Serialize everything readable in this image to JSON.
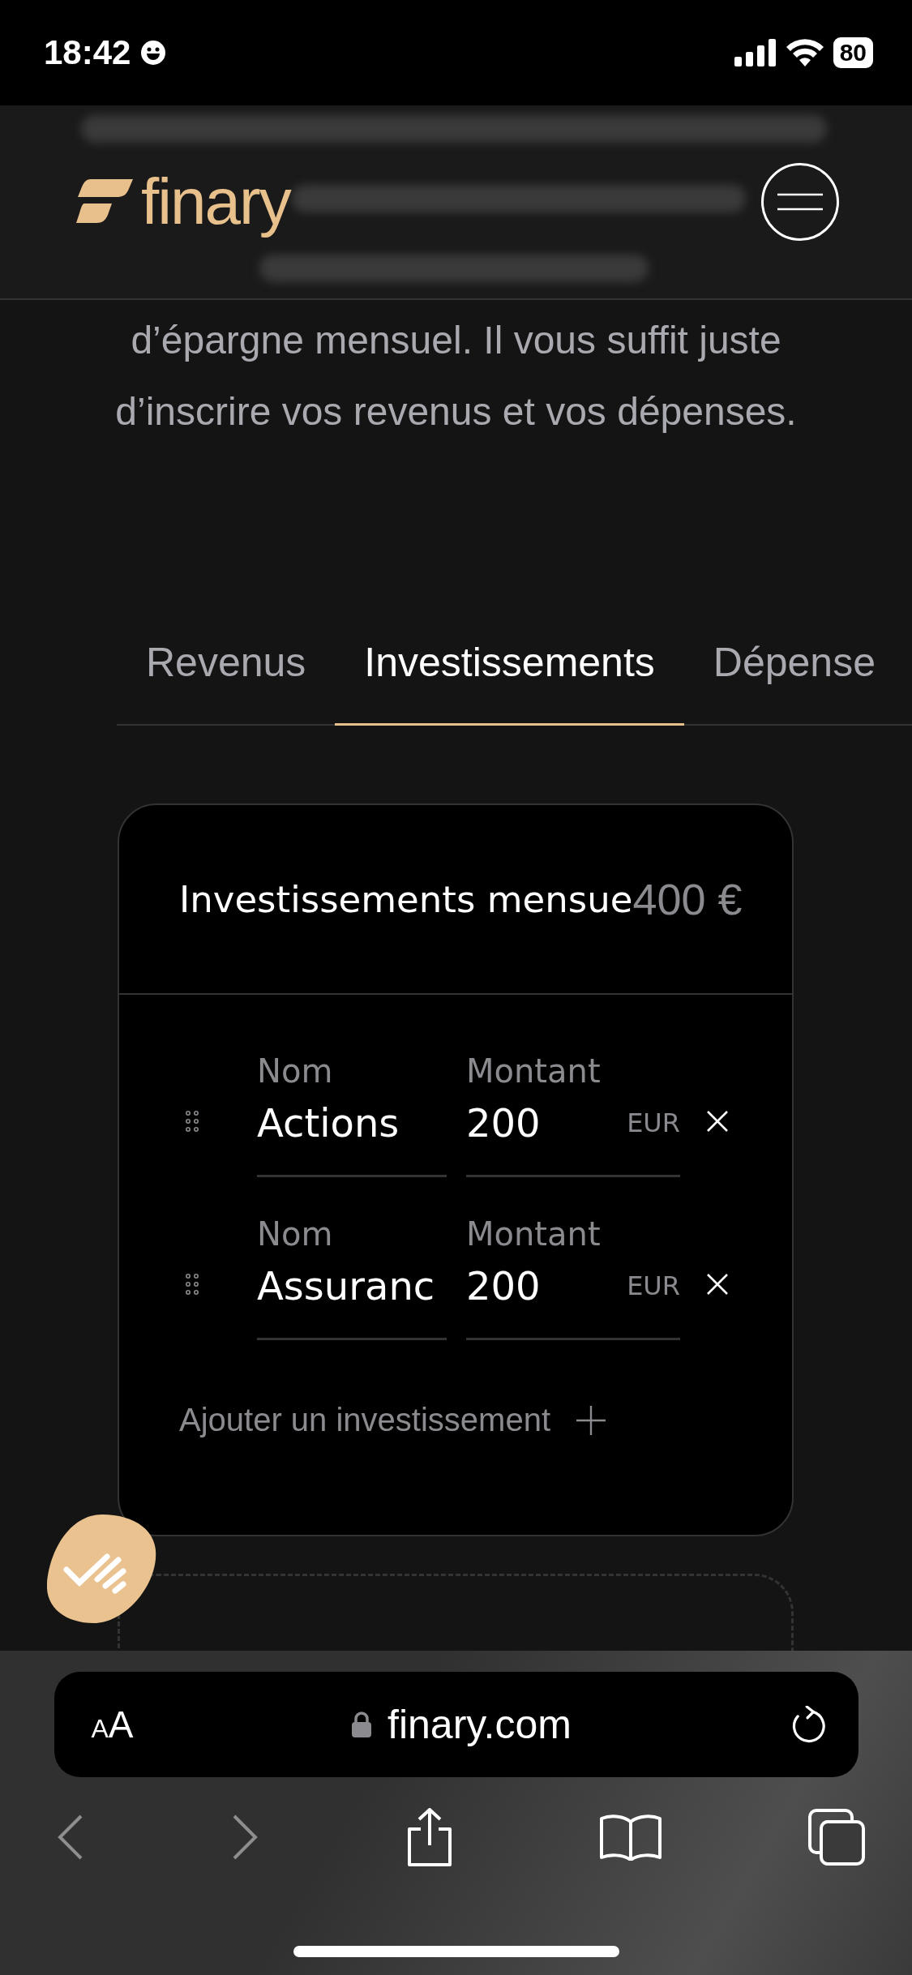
{
  "status_bar": {
    "time": "18:42",
    "battery": "80"
  },
  "header": {
    "logo": "finary"
  },
  "intro": [
    "d’épargne mensuel. Il vous suffit juste",
    "d’inscrire vos revenus et vos dépenses."
  ],
  "tabs": [
    {
      "label": "Revenus",
      "selected": false
    },
    {
      "label": "Investissements",
      "selected": true
    },
    {
      "label": "Dépense",
      "selected": false
    }
  ],
  "card": {
    "title": "Investissements mensue",
    "total": "400 €",
    "rows": [
      {
        "name_label": "Nom",
        "name": "Actions",
        "amount_label": "Montant",
        "amount": "200",
        "currency": "EUR"
      },
      {
        "name_label": "Nom",
        "name": "Assuranc",
        "amount_label": "Montant",
        "amount": "200",
        "currency": "EUR"
      }
    ],
    "add_label": "Ajouter un investissement"
  },
  "browser": {
    "text_size": "AA",
    "url": "finary.com"
  }
}
